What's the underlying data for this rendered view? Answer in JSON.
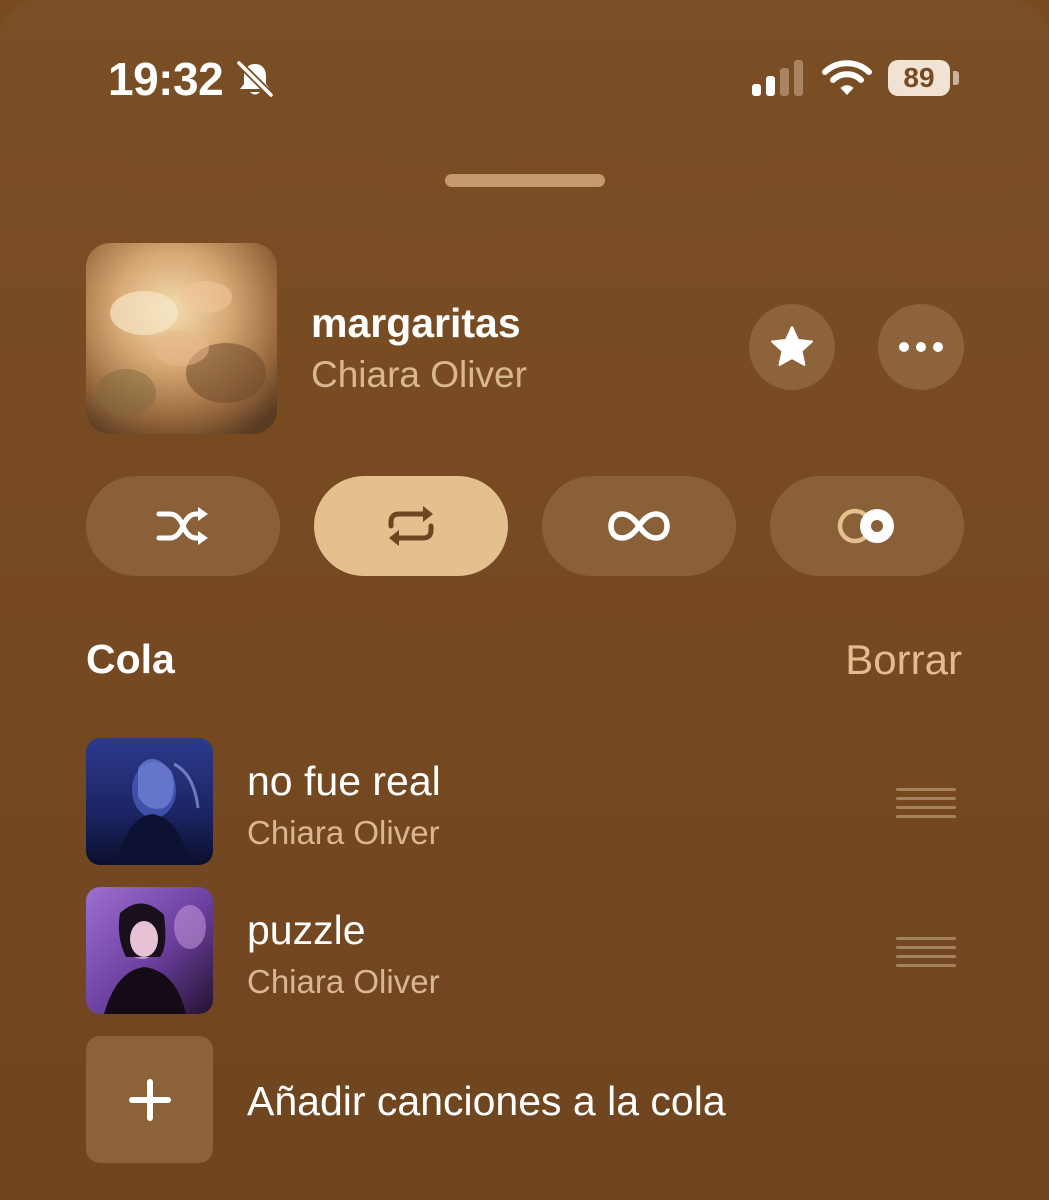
{
  "status_bar": {
    "time": "19:32",
    "battery": "89",
    "icons": [
      "bell-off-icon",
      "cellular-signal-icon",
      "wifi-icon",
      "battery-icon"
    ]
  },
  "now_playing": {
    "title": "margaritas",
    "artist": "Chiara Oliver",
    "actions": [
      {
        "name": "favorite",
        "icon": "star-icon"
      },
      {
        "name": "more",
        "icon": "ellipsis-icon"
      }
    ]
  },
  "playback_modes": [
    {
      "name": "shuffle",
      "icon": "shuffle-icon",
      "active": false
    },
    {
      "name": "repeat",
      "icon": "repeat-icon",
      "active": true
    },
    {
      "name": "autoplay",
      "icon": "infinity-icon",
      "active": false
    },
    {
      "name": "crossfade",
      "icon": "crossfade-icon",
      "active": false
    }
  ],
  "queue": {
    "heading": "Cola",
    "clear_label": "Borrar",
    "items": [
      {
        "title": "no fue real",
        "artist": "Chiara Oliver"
      },
      {
        "title": "puzzle",
        "artist": "Chiara Oliver"
      }
    ],
    "add_label": "Añadir canciones a la cola"
  },
  "colors": {
    "background": "#774a22",
    "accent": "#e5c08f",
    "secondary_text": "#d9b792"
  }
}
